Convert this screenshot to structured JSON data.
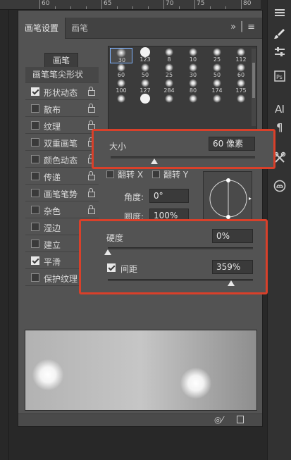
{
  "ruler": {
    "marks": [
      "60",
      "65",
      "70",
      "75",
      "80"
    ]
  },
  "tabs": [
    {
      "label": "画笔设置",
      "active": true
    },
    {
      "label": "画笔",
      "active": false
    }
  ],
  "panel_menu_icons": {
    "collapse": "double-chevron-right-icon",
    "menu": "hamburger-menu-icon"
  },
  "brush_button_label": "画笔",
  "sidebar": {
    "header": "画笔笔尖形状",
    "items": [
      {
        "label": "形状动态",
        "checked": true
      },
      {
        "label": "散布",
        "checked": false
      },
      {
        "label": "纹理",
        "checked": false
      },
      {
        "label": "双重画笔",
        "checked": false
      },
      {
        "label": "颜色动态",
        "checked": false
      },
      {
        "label": "传递",
        "checked": false
      },
      {
        "label": "画笔笔势",
        "checked": false
      },
      {
        "label": "杂色",
        "checked": false
      },
      {
        "label": "湿边",
        "checked": false
      },
      {
        "label": "建立",
        "checked": false
      },
      {
        "label": "平滑",
        "checked": true
      },
      {
        "label": "保护纹理",
        "checked": false
      }
    ]
  },
  "brush_presets": [
    {
      "size": "30",
      "kind": "soft"
    },
    {
      "size": "123",
      "kind": "hard"
    },
    {
      "size": "8",
      "kind": "splat"
    },
    {
      "size": "10",
      "kind": "splat"
    },
    {
      "size": "25",
      "kind": "splat"
    },
    {
      "size": "112",
      "kind": "splat"
    },
    {
      "size": "60",
      "kind": "splat"
    },
    {
      "size": "50",
      "kind": "splat"
    },
    {
      "size": "25",
      "kind": "splat"
    },
    {
      "size": "30",
      "kind": "splat"
    },
    {
      "size": "50",
      "kind": "splat"
    },
    {
      "size": "60",
      "kind": "splat"
    },
    {
      "size": "100",
      "kind": "splat"
    },
    {
      "size": "127",
      "kind": "splat"
    },
    {
      "size": "284",
      "kind": "splat"
    },
    {
      "size": "80",
      "kind": "splat"
    },
    {
      "size": "174",
      "kind": "splat"
    },
    {
      "size": "175",
      "kind": "splat"
    },
    {
      "size": "",
      "kind": "splat"
    },
    {
      "size": "",
      "kind": "hard"
    },
    {
      "size": "",
      "kind": "splat"
    },
    {
      "size": "",
      "kind": "splat"
    },
    {
      "size": "",
      "kind": "splat"
    },
    {
      "size": "",
      "kind": "splat"
    }
  ],
  "size": {
    "label": "大小",
    "value": "60 像素",
    "slider_level": 0.3
  },
  "flip": {
    "x_label": "翻转 X",
    "y_label": "翻转 Y",
    "x_checked": false,
    "y_checked": false
  },
  "angle": {
    "label": "角度:",
    "value": "0°"
  },
  "roundness": {
    "label": "圆度:",
    "value": "100%"
  },
  "hardness": {
    "label": "硬度",
    "value": "0%",
    "slider_level": 0.0
  },
  "spacing": {
    "label": "间距",
    "value": "359%",
    "checked": true,
    "slider_level": 0.85
  },
  "footer_icons": [
    "eye-pen-icon",
    "new-preset-icon"
  ],
  "right_toolbar_icons": [
    "menu-icon",
    "brush-icon",
    "adjustments-icon",
    "photoshop-icon",
    "paragraph-text-icon",
    "paragraph-icon",
    "tools-icon",
    "creative-cloud-icon"
  ],
  "colors": {
    "highlight": "#d9402a",
    "panel": "#535353",
    "accent": "#7fb3ff"
  }
}
